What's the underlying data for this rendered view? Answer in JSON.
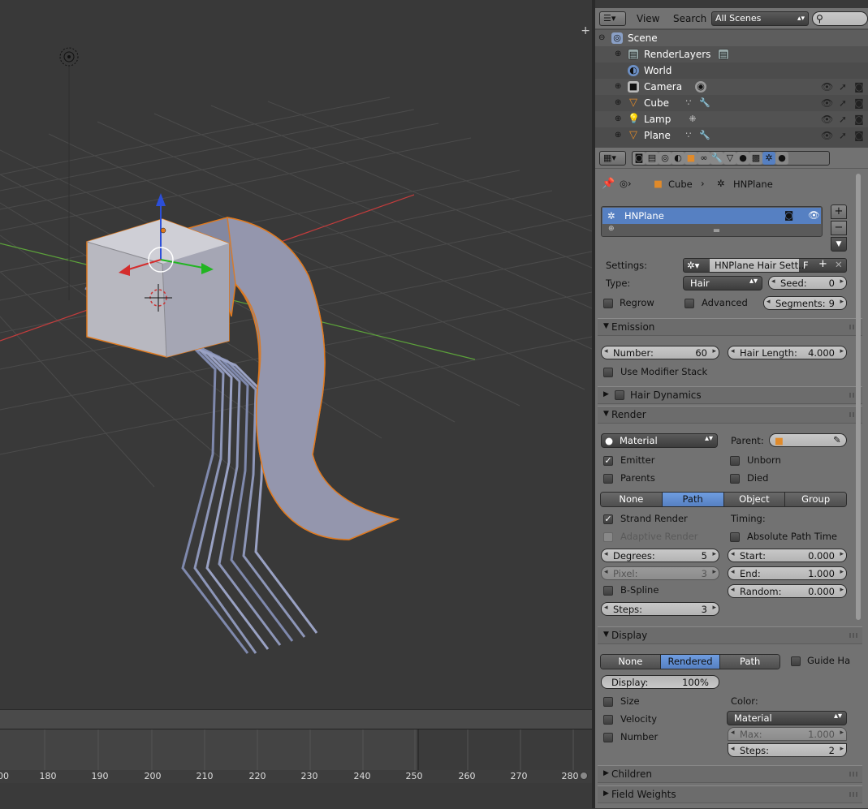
{
  "outliner": {
    "view_menu": "View",
    "search_menu": "Search",
    "scene_selector": "All Scenes",
    "rows": [
      {
        "label": "Scene"
      },
      {
        "label": "RenderLayers"
      },
      {
        "label": "World"
      },
      {
        "label": "Camera"
      },
      {
        "label": "Cube"
      },
      {
        "label": "Lamp"
      },
      {
        "label": "Plane"
      }
    ]
  },
  "properties": {
    "breadcrumb": {
      "object": "Cube",
      "system": "HNPlane"
    },
    "particle_list": {
      "selected": "HNPlane"
    },
    "settings_label": "Settings:",
    "settings_name": "HNPlane Hair Sett...",
    "fake_user": "F",
    "type_label": "Type:",
    "type_value": "Hair",
    "seed_label": "Seed:",
    "seed_value": "0",
    "regrow_label": "Regrow",
    "advanced_label": "Advanced",
    "segments_label": "Segments:",
    "segments_value": "9",
    "emission": {
      "title": "Emission",
      "number_label": "Number:",
      "number_value": "60",
      "hair_length_label": "Hair Length:",
      "hair_length_value": "4.000",
      "use_modifier_stack": "Use Modifier Stack"
    },
    "hair_dynamics": {
      "title": "Hair Dynamics"
    },
    "render": {
      "title": "Render",
      "material_dd": "Material",
      "parent_label": "Parent:",
      "emitter": "Emitter",
      "unborn": "Unborn",
      "parents": "Parents",
      "died": "Died",
      "modes": [
        "None",
        "Path",
        "Object",
        "Group"
      ],
      "mode_selected": "Path",
      "strand_render": "Strand Render",
      "timing_label": "Timing:",
      "adaptive_render": "Adaptive Render",
      "absolute_path_time": "Absolute Path Time",
      "degrees_label": "Degrees:",
      "degrees_value": "5",
      "start_label": "Start:",
      "start_value": "0.000",
      "pixel_label": "Pixel:",
      "pixel_value": "3",
      "end_label": "End:",
      "end_value": "1.000",
      "bspline": "B-Spline",
      "random_label": "Random:",
      "random_value": "0.000",
      "steps_label": "Steps:",
      "steps_value": "3"
    },
    "display": {
      "title": "Display",
      "modes": [
        "None",
        "Rendered",
        "Path"
      ],
      "mode_selected": "Rendered",
      "guide_hairs": "Guide Ha",
      "display_label": "Display:",
      "display_value": "100%",
      "size": "Size",
      "velocity": "Velocity",
      "number": "Number",
      "color_label": "Color:",
      "color_dd": "Material",
      "max_label": "Max:",
      "max_value": "1.000",
      "steps_label": "Steps:",
      "steps_value": "2"
    },
    "children": {
      "title": "Children"
    },
    "field_weights": {
      "title": "Field Weights"
    }
  },
  "timeline": {
    "ticks": [
      "00",
      "180",
      "190",
      "200",
      "210",
      "220",
      "230",
      "240",
      "250",
      "260",
      "270",
      "280"
    ]
  },
  "colors": {
    "viewport_bg": "#393939",
    "selection_outline": "#e07a1f",
    "hair_color": "#8d96b8",
    "highlight_blue": "#5680c2",
    "x_axis": "#c43c3c",
    "y_axis": "#5ca23a"
  }
}
